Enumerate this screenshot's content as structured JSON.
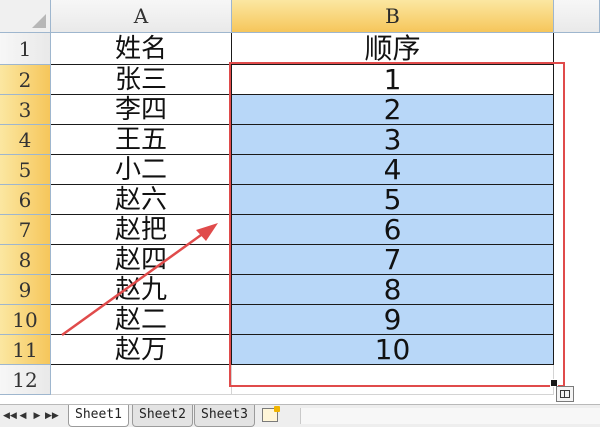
{
  "columns": [
    {
      "label": "A",
      "selected": false
    },
    {
      "label": "B",
      "selected": true
    }
  ],
  "rows": [
    {
      "num": "1",
      "name": "姓名",
      "order": "顺序",
      "selected": false
    },
    {
      "num": "2",
      "name": "张三",
      "order": "1",
      "selected": true
    },
    {
      "num": "3",
      "name": "李四",
      "order": "2",
      "selected": true
    },
    {
      "num": "4",
      "name": "王五",
      "order": "3",
      "selected": true
    },
    {
      "num": "5",
      "name": "小二",
      "order": "4",
      "selected": true
    },
    {
      "num": "6",
      "name": "赵六",
      "order": "5",
      "selected": true
    },
    {
      "num": "7",
      "name": "赵把",
      "order": "6",
      "selected": true
    },
    {
      "num": "8",
      "name": "赵四",
      "order": "7",
      "selected": true
    },
    {
      "num": "9",
      "name": "赵九",
      "order": "8",
      "selected": true
    },
    {
      "num": "10",
      "name": "赵二",
      "order": "9",
      "selected": true
    },
    {
      "num": "11",
      "name": "赵万",
      "order": "10",
      "selected": true
    },
    {
      "num": "12",
      "name": "",
      "order": "",
      "selected": false
    }
  ],
  "tabs": [
    {
      "label": "Sheet1",
      "active": true
    },
    {
      "label": "Sheet2",
      "active": false
    },
    {
      "label": "Sheet3",
      "active": false
    }
  ],
  "nav_buttons": [
    "◀◀",
    "◀",
    "▶",
    "▶▶"
  ],
  "colors": {
    "selection_fill": "#b8d7f8",
    "annotation_red": "#e04b4b",
    "header_highlight": "#f6c65b"
  },
  "icons": {
    "autofill": "autofill-options-icon",
    "new_sheet": "insert-sheet-icon"
  }
}
